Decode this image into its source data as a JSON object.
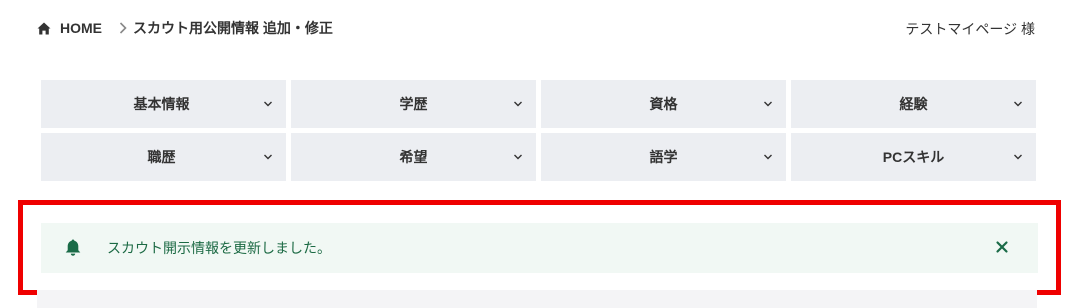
{
  "breadcrumb": {
    "home_label": "HOME",
    "current_label": "スカウト用公開情報 追加・修正"
  },
  "user": {
    "display_name": "テストマイページ 様"
  },
  "nav": {
    "items": [
      {
        "label": "基本情報"
      },
      {
        "label": "学歴"
      },
      {
        "label": "資格"
      },
      {
        "label": "経験"
      },
      {
        "label": "職歴"
      },
      {
        "label": "希望"
      },
      {
        "label": "語学"
      },
      {
        "label": "PCスキル"
      }
    ]
  },
  "alert": {
    "message": "スカウト開示情報を更新しました。",
    "icon": "bell-icon",
    "close_icon": "close-icon"
  },
  "colors": {
    "highlight_border": "#ef0000",
    "alert_bg": "#f1f8f4",
    "alert_text": "#1c6a44",
    "nav_bg": "#eceef2"
  }
}
